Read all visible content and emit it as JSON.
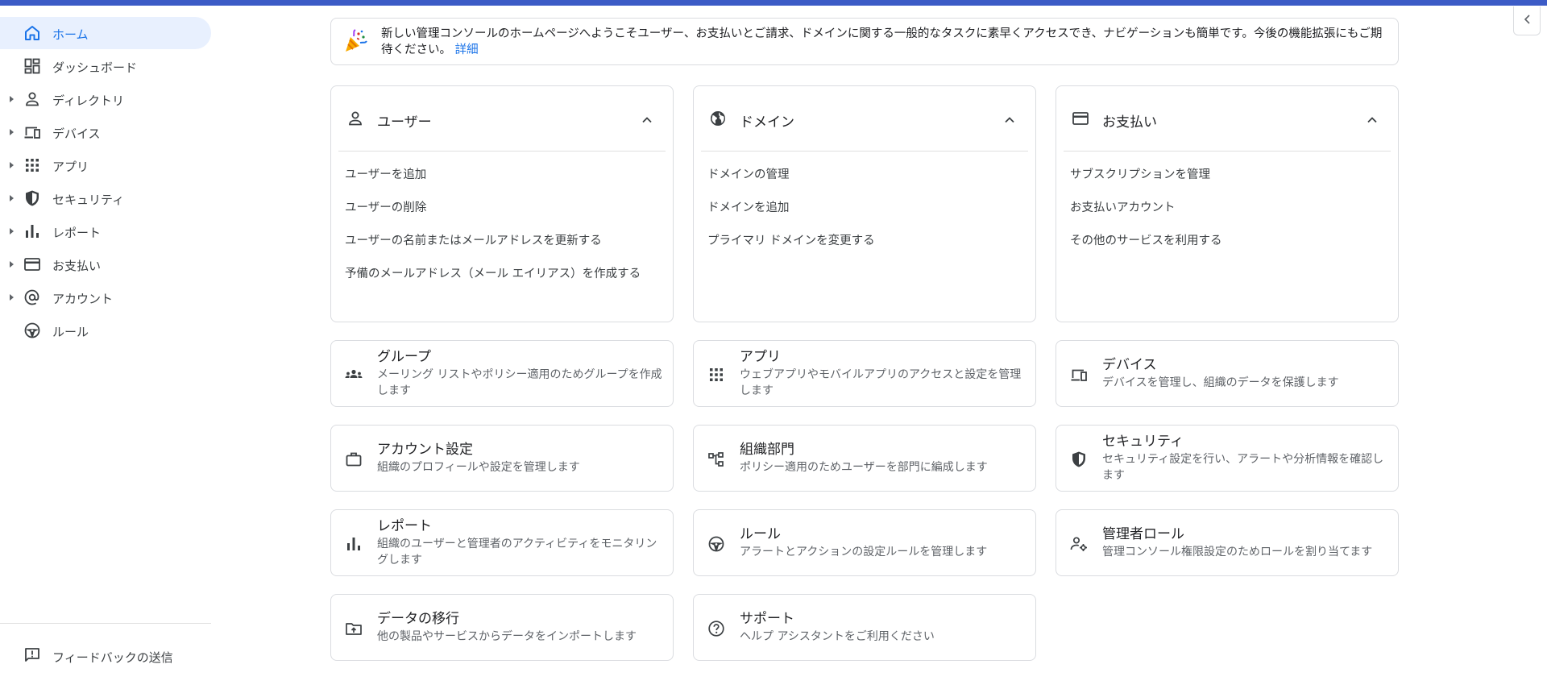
{
  "banner": {
    "text": "新しい管理コンソールのホームページへようこそユーザー、お支払いとご請求、ドメインに関する一般的なタスクに素早くアクセスでき、ナビゲーションも簡単です。今後の機能拡張にもご期待ください。",
    "link": "詳細",
    "icon": "party-popper-icon"
  },
  "sidebar": {
    "items": [
      {
        "label": "ホーム",
        "icon": "home-icon",
        "active": true,
        "expandable": false
      },
      {
        "label": "ダッシュボード",
        "icon": "dashboard-icon",
        "active": false,
        "expandable": false
      },
      {
        "label": "ディレクトリ",
        "icon": "person-icon",
        "active": false,
        "expandable": true
      },
      {
        "label": "デバイス",
        "icon": "devices-icon",
        "active": false,
        "expandable": true
      },
      {
        "label": "アプリ",
        "icon": "apps-grid-icon",
        "active": false,
        "expandable": true
      },
      {
        "label": "セキュリティ",
        "icon": "shield-icon",
        "active": false,
        "expandable": true
      },
      {
        "label": "レポート",
        "icon": "bar-chart-icon",
        "active": false,
        "expandable": true
      },
      {
        "label": "お支払い",
        "icon": "credit-card-icon",
        "active": false,
        "expandable": true
      },
      {
        "label": "アカウント",
        "icon": "at-sign-icon",
        "active": false,
        "expandable": true
      },
      {
        "label": "ルール",
        "icon": "steering-wheel-icon",
        "active": false,
        "expandable": false
      }
    ],
    "feedback_label": "フィードバックの送信"
  },
  "cards": [
    {
      "title": "ユーザー",
      "icon": "person-icon",
      "links": [
        "ユーザーを追加",
        "ユーザーの削除",
        "ユーザーの名前またはメールアドレスを更新する",
        "予備のメールアドレス（メール エイリアス）を作成する"
      ]
    },
    {
      "title": "ドメイン",
      "icon": "globe-icon",
      "links": [
        "ドメインの管理",
        "ドメインを追加",
        "プライマリ ドメインを変更する"
      ]
    },
    {
      "title": "お支払い",
      "icon": "credit-card-icon",
      "links": [
        "サブスクリプションを管理",
        "お支払いアカウント",
        "その他のサービスを利用する"
      ]
    }
  ],
  "tiles": [
    {
      "title": "グループ",
      "desc": "メーリング リストやポリシー適用のためグループを作成します",
      "icon": "groups-icon"
    },
    {
      "title": "アプリ",
      "desc": "ウェブアプリやモバイルアプリのアクセスと設定を管理します",
      "icon": "apps-grid-icon"
    },
    {
      "title": "デバイス",
      "desc": "デバイスを管理し、組織のデータを保護します",
      "icon": "devices-icon"
    },
    {
      "title": "アカウント設定",
      "desc": "組織のプロフィールや設定を管理します",
      "icon": "briefcase-icon"
    },
    {
      "title": "組織部門",
      "desc": "ポリシー適用のためユーザーを部門に編成します",
      "icon": "org-tree-icon"
    },
    {
      "title": "セキュリティ",
      "desc": "セキュリティ設定を行い、アラートや分析情報を確認します",
      "icon": "shield-icon"
    },
    {
      "title": "レポート",
      "desc": "組織のユーザーと管理者のアクティビティをモニタリングします",
      "icon": "bar-chart-icon"
    },
    {
      "title": "ルール",
      "desc": "アラートとアクションの設定ルールを管理します",
      "icon": "steering-wheel-icon"
    },
    {
      "title": "管理者ロール",
      "desc": "管理コンソール権限設定のためロールを割り当てます",
      "icon": "admin-roles-icon"
    },
    {
      "title": "データの移行",
      "desc": "他の製品やサービスからデータをインポートします",
      "icon": "data-migration-icon"
    },
    {
      "title": "サポート",
      "desc": "ヘルプ アシスタントをご利用ください",
      "icon": "help-icon"
    }
  ],
  "colors": {
    "accent": "#1a73e8",
    "topbar": "#3c5bc6",
    "active_bg": "#e8f0fe",
    "border": "#dadce0"
  }
}
